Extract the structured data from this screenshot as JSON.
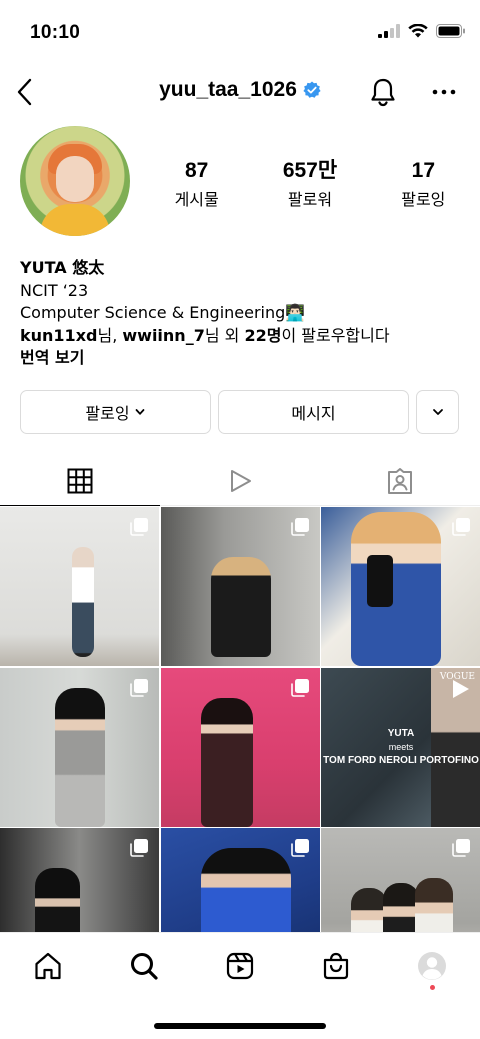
{
  "status_bar": {
    "time": "10:10"
  },
  "header": {
    "username": "yuu_taa_1026",
    "verified": true
  },
  "stats": [
    {
      "value": "87",
      "label": "게시물"
    },
    {
      "value": "657만",
      "label": "팔로워"
    },
    {
      "value": "17",
      "label": "팔로잉"
    }
  ],
  "bio": {
    "name": "YUTA 悠太",
    "line1": "NCIT ‘23",
    "line2": "Computer Science & Engineering",
    "line2_emoji": "👨🏻‍💻",
    "followed_by_user1": "kun11xd",
    "followed_by_sep1": "님, ",
    "followed_by_user2": "wwiinn_7",
    "followed_by_sep2": "님 외 ",
    "followed_by_count": "22명",
    "followed_by_tail": "이 팔로우합니다",
    "translate": "번역 보기"
  },
  "buttons": {
    "following": "팔로잉",
    "message": "메시지"
  },
  "posts": [
    {
      "type": "multi"
    },
    {
      "type": "multi"
    },
    {
      "type": "multi"
    },
    {
      "type": "multi"
    },
    {
      "type": "multi"
    },
    {
      "type": "reel",
      "text_top": "YUTA",
      "text_mid": "meets",
      "text_bottom": "TOM FORD NEROLI PORTOFINO",
      "brand": "VOGUE"
    },
    {
      "type": "multi"
    },
    {
      "type": "multi"
    },
    {
      "type": "multi"
    }
  ],
  "colors": {
    "verified": "#3897f0",
    "notification_dot": "#ed4956",
    "border": "#dbdbdb"
  },
  "icons": [
    "back-icon",
    "verified-icon",
    "bell-icon",
    "more-icon",
    "grid-icon",
    "reels-icon",
    "tagged-icon",
    "home-icon",
    "search-icon",
    "reels-nav-icon",
    "shop-icon",
    "profile-icon"
  ]
}
